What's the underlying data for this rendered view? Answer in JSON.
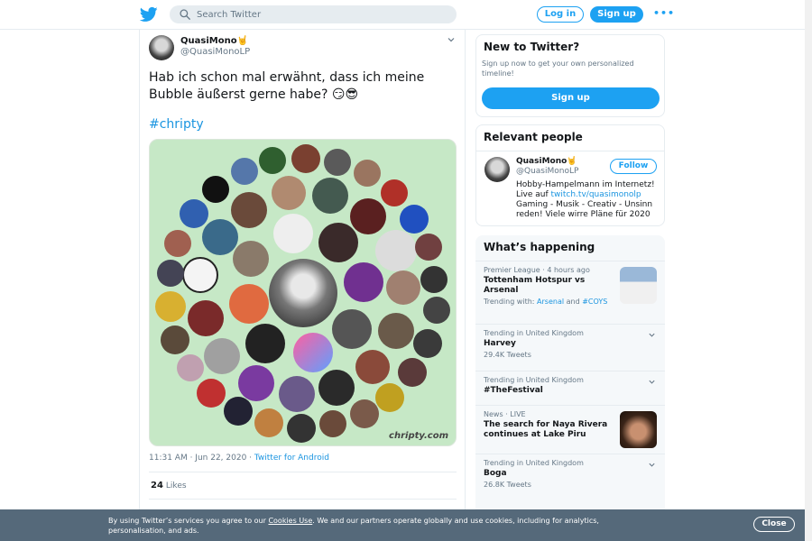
{
  "header": {
    "search_placeholder": "Search Twitter",
    "login_label": "Log in",
    "signup_label": "Sign up",
    "more_label": "•••"
  },
  "tweet": {
    "display_name": "QuasiMono🤘",
    "username": "@QuasiMonoLP",
    "text": "Hab ich schon mal erwähnt, dass ich meine Bubble äußerst gerne habe? 😏😎",
    "hashtag": "#chripty",
    "image_watermark": "chripty.com",
    "timestamp": "11:31 AM · Jun 22, 2020 · ",
    "source": "Twitter for Android",
    "likes_count": "24",
    "likes_label": "Likes"
  },
  "new_to_twitter": {
    "title": "New to Twitter?",
    "subtitle": "Sign up now to get your own personalized timeline!",
    "signup_label": "Sign up"
  },
  "relevant_people": {
    "title": "Relevant people",
    "name": "QuasiMono🤘",
    "handle": "@QuasiMonoLP",
    "follow_label": "Follow",
    "bio_prefix": "Hobby-Hampelmann im Internetz! Live auf ",
    "bio_link": "twitch.tv/quasimonolp",
    "bio_suffix": " Gaming - Musik - Creativ - Unsinn reden! Viele wirre Pläne für 2020"
  },
  "whats_happening": {
    "title": "What’s happening",
    "trends": [
      {
        "meta": "Premier League · 4 hours ago",
        "title": "Tottenham Hotspur vs Arsenal",
        "sub_prefix": "Trending with: ",
        "sub_link1": "Arsenal",
        "sub_mid": " and ",
        "sub_link2": "#COYS"
      },
      {
        "meta": "Trending in United Kingdom",
        "title": "Harvey",
        "sub": "29.4K Tweets"
      },
      {
        "meta": "Trending in United Kingdom",
        "title": "#TheFestival"
      },
      {
        "meta": "News · LIVE",
        "title": "The search for Naya Rivera continues at Lake Piru"
      },
      {
        "meta": "Trending in United Kingdom",
        "title": "Boga",
        "sub": "26.8K Tweets"
      }
    ]
  },
  "cookie": {
    "text_prefix": "By using Twitter’s services you agree to our ",
    "link": "Cookies Use",
    "text_suffix": ". We and our partners operate globally and use cookies, including for analytics, personalisation, and ads.",
    "close_label": "Close"
  },
  "colors": {
    "brand": "#1da1f2",
    "link": "#1b95e0",
    "image_bg": "#c6e8c6",
    "banner": "#55697a"
  }
}
